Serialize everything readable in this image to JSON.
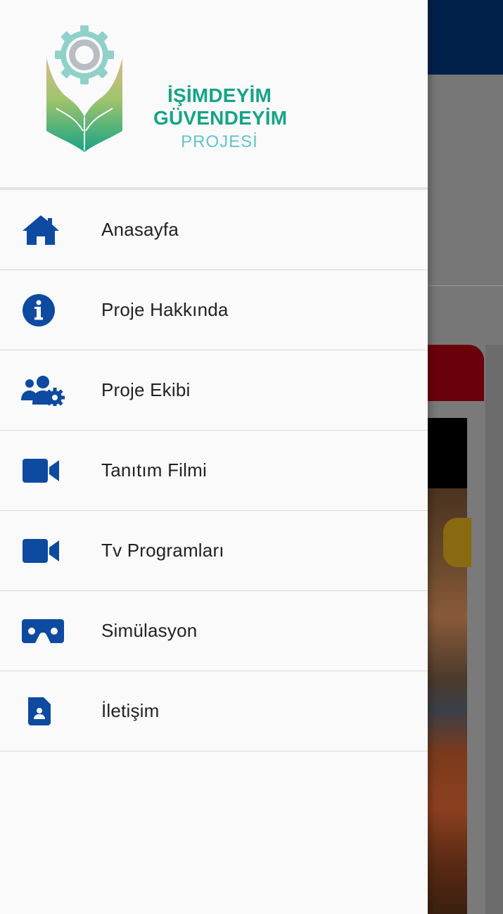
{
  "brand": {
    "line1": "İŞİMDEYİM",
    "line2": "GÜVENDEYİM",
    "line3": "PROJESİ",
    "primary_color": "#17a386",
    "secondary_color": "#64c3c9"
  },
  "theme": {
    "icon_color": "#0d4aa0",
    "header_bar_color": "#02214a",
    "card_header_color": "#6a000a"
  },
  "menu": {
    "items": [
      {
        "label": "Anasayfa",
        "icon": "home-icon"
      },
      {
        "label": "Proje Hakkında",
        "icon": "info-icon"
      },
      {
        "label": "Proje Ekibi",
        "icon": "team-settings-icon"
      },
      {
        "label": "Tanıtım Filmi",
        "icon": "video-camera-icon"
      },
      {
        "label": "Tv Programları",
        "icon": "video-camera-icon"
      },
      {
        "label": "Simülasyon",
        "icon": "vr-headset-icon"
      },
      {
        "label": "İletişim",
        "icon": "contact-card-icon"
      }
    ]
  }
}
